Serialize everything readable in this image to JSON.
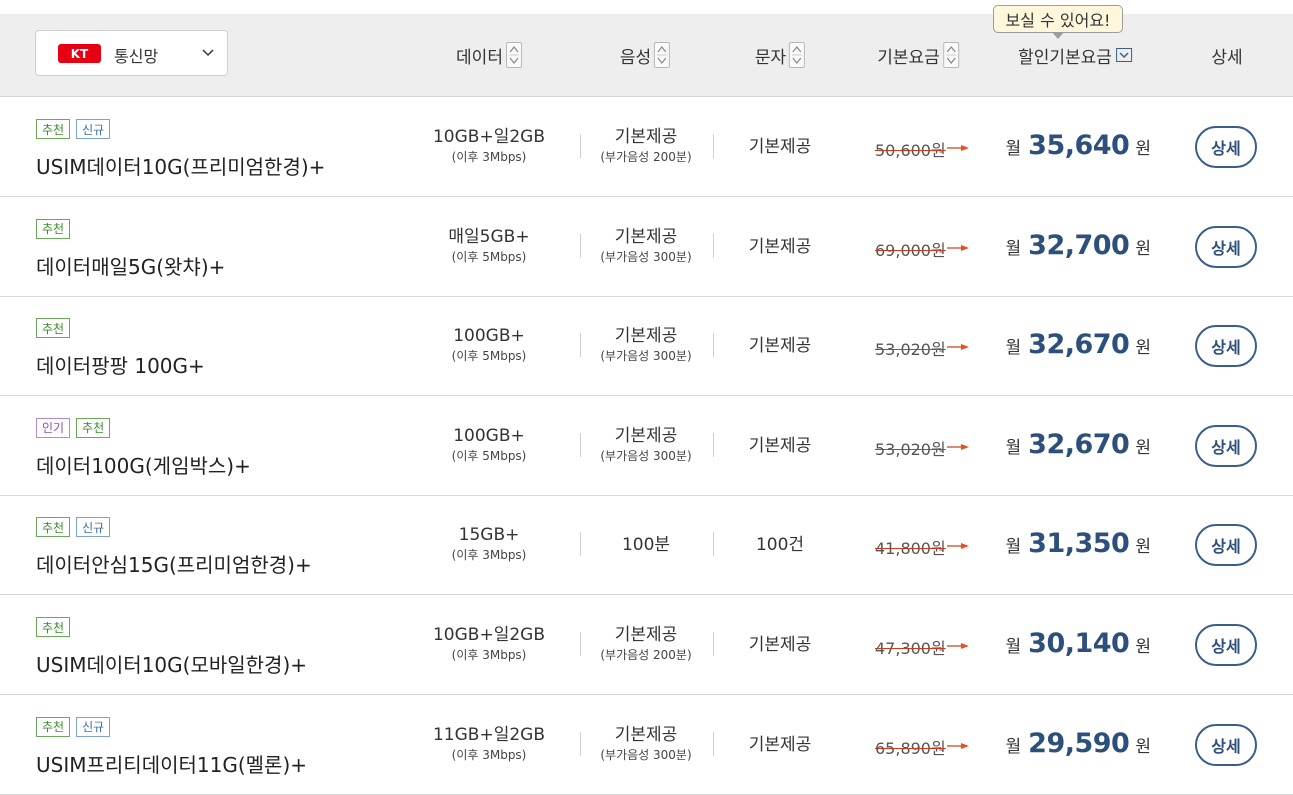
{
  "filter": {
    "badge": "KT",
    "label": "통신망"
  },
  "tooltip": {
    "text": "보실 수 있어요!"
  },
  "columns": {
    "data": "데이터",
    "voice": "음성",
    "sms": "문자",
    "base_fee": "기본요금",
    "discount_fee": "할인기본요금",
    "detail": "상세"
  },
  "colors": {
    "kt_red": "#e60012",
    "accent_blue": "#2d4f7c",
    "strike_red": "#cc3a1a",
    "tag_green": "#3d8a2e",
    "tag_blue": "#3a6ea5",
    "tag_purple": "#8a4fb0"
  },
  "icons": {
    "sort": "sort-updown-icon",
    "download": "chevron-down-box-icon",
    "dropdown": "chevron-down-icon",
    "price_arrow": "arrow-right-icon"
  },
  "plans": [
    {
      "tags": [
        {
          "type": "rec",
          "label": "추천"
        },
        {
          "type": "new",
          "label": "신규"
        }
      ],
      "name": "USIM데이터10G(프리미엄한경)+",
      "data_main": "10GB+일2GB",
      "data_sub": "(이후 3Mbps)",
      "voice_main": "기본제공",
      "voice_sub": "(부가음성 200분)",
      "sms": "기본제공",
      "base_price": "50,600원",
      "month": "월",
      "price": "35,640",
      "unit": "원",
      "detail": "상세"
    },
    {
      "tags": [
        {
          "type": "rec",
          "label": "추천"
        }
      ],
      "name": "데이터매일5G(왓챠)+",
      "data_main": "매일5GB+",
      "data_sub": "(이후 5Mbps)",
      "voice_main": "기본제공",
      "voice_sub": "(부가음성 300분)",
      "sms": "기본제공",
      "base_price": "69,000원",
      "month": "월",
      "price": "32,700",
      "unit": "원",
      "detail": "상세"
    },
    {
      "tags": [
        {
          "type": "rec",
          "label": "추천"
        }
      ],
      "name": "데이터팡팡 100G+",
      "data_main": "100GB+",
      "data_sub": "(이후 5Mbps)",
      "voice_main": "기본제공",
      "voice_sub": "(부가음성 300분)",
      "sms": "기본제공",
      "base_price": "53,020원",
      "month": "월",
      "price": "32,670",
      "unit": "원",
      "detail": "상세"
    },
    {
      "tags": [
        {
          "type": "pop",
          "label": "인기"
        },
        {
          "type": "rec",
          "label": "추천"
        }
      ],
      "name": "데이터100G(게임박스)+",
      "data_main": "100GB+",
      "data_sub": "(이후 5Mbps)",
      "voice_main": "기본제공",
      "voice_sub": "(부가음성 300분)",
      "sms": "기본제공",
      "base_price": "53,020원",
      "month": "월",
      "price": "32,670",
      "unit": "원",
      "detail": "상세"
    },
    {
      "tags": [
        {
          "type": "rec",
          "label": "추천"
        },
        {
          "type": "new",
          "label": "신규"
        }
      ],
      "name": "데이터안심15G(프리미엄한경)+",
      "data_main": "15GB+",
      "data_sub": "(이후 3Mbps)",
      "voice_main": "100분",
      "voice_sub": "",
      "sms": "100건",
      "base_price": "41,800원",
      "month": "월",
      "price": "31,350",
      "unit": "원",
      "detail": "상세"
    },
    {
      "tags": [
        {
          "type": "rec",
          "label": "추천"
        }
      ],
      "name": "USIM데이터10G(모바일한경)+",
      "data_main": "10GB+일2GB",
      "data_sub": "(이후 3Mbps)",
      "voice_main": "기본제공",
      "voice_sub": "(부가음성 200분)",
      "sms": "기본제공",
      "base_price": "47,300원",
      "month": "월",
      "price": "30,140",
      "unit": "원",
      "detail": "상세"
    },
    {
      "tags": [
        {
          "type": "rec",
          "label": "추천"
        },
        {
          "type": "new",
          "label": "신규"
        }
      ],
      "name": "USIM프리티데이터11G(멜론)+",
      "data_main": "11GB+일2GB",
      "data_sub": "(이후 3Mbps)",
      "voice_main": "기본제공",
      "voice_sub": "(부가음성 300분)",
      "sms": "기본제공",
      "base_price": "65,890원",
      "month": "월",
      "price": "29,590",
      "unit": "원",
      "detail": "상세"
    }
  ]
}
